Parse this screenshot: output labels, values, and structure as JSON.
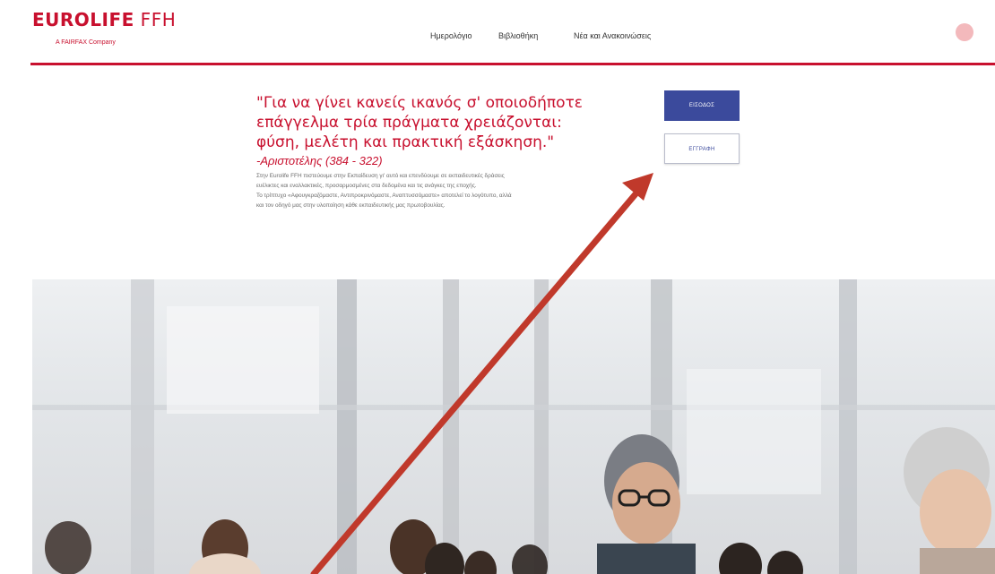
{
  "header": {
    "brand": {
      "name_part1": "EUROLIFE",
      "name_part2": " FFH",
      "subtitle": "A FAIRFAX Company"
    },
    "nav": [
      {
        "label": "Ημερολόγιο"
      },
      {
        "label": "Βιβλιοθήκη"
      },
      {
        "label": "Νέα και Ανακοινώσεις"
      }
    ]
  },
  "intro": {
    "quote": "\"Για να γίνει κανείς ικανός σ' οποιοδήποτε επάγγελμα τρία πράγματα χρειάζονται: φύση, μελέτη και πρακτική εξάσκηση.\"",
    "author": "-Αριστοτέλης (384 - 322)",
    "description_lines": [
      "Στην Eurolife FFH πιστεύουμε στην Εκπαίδευση γι' αυτό και επενδύουμε σε εκπαιδευτικές δράσεις",
      "ευέλικτες και εναλλακτικές, προσαρμοσμένες στα δεδομένα και τις ανάγκες της εποχής.",
      "Το τρίπτυχο «Αφουγκραζόμαστε, Αντιπροκρινόμαστε, Αναπτυσσόμαστε» αποτελεί το λογότυπο, αλλά",
      "και τον οδηγό μας στην υλοποίηση κάθε εκπαιδευτικής μας πρωτοβουλίας."
    ]
  },
  "buttons": {
    "login": "ΕΙΣΟΔΟΣ",
    "register": "ΕΓΓΡΑΦΗ"
  },
  "colors": {
    "brand_red": "#c8102e",
    "button_blue": "#3b4a9c",
    "arrow_red": "#c0392b"
  },
  "icons": {
    "avatar": "user-avatar-icon",
    "annotation": "arrow-annotation-icon"
  }
}
